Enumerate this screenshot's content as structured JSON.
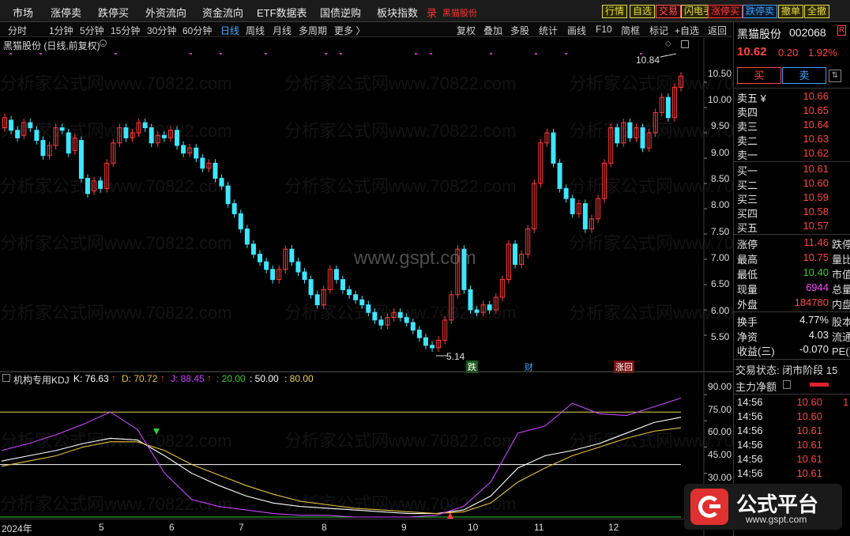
{
  "menu": {
    "items": [
      "市场",
      "涨停卖",
      "跌停买",
      "外资流向",
      "资金流向",
      "ETF数据表",
      "国债逆购",
      "板块指数"
    ],
    "record_label": "录",
    "stock_name_red": "黑猫股份"
  },
  "right_buttons": [
    {
      "label": "行情",
      "color": "#e8d84a",
      "bg": "#2a2a00"
    },
    {
      "label": "自选",
      "color": "#e8d84a",
      "bg": "#2a2a00"
    },
    {
      "label": "交易",
      "color": "#ff5555",
      "bg": "#2a0a0a"
    },
    {
      "label": "闪电手",
      "color": "#e8d84a",
      "bg": "#2a2a00"
    },
    {
      "label": "涨停买",
      "color": "#ff3b3b",
      "bg": "#2a0a0a"
    },
    {
      "label": "跌停卖",
      "color": "#3aa0ff",
      "bg": "#0a1a2a"
    },
    {
      "label": "撤单",
      "color": "#e8d84a",
      "bg": "#2a2a00"
    },
    {
      "label": "全撤",
      "color": "#e8d84a",
      "bg": "#2a2a00"
    }
  ],
  "periods": [
    "分时",
    "1分钟",
    "5分钟",
    "15分钟",
    "30分钟",
    "60分钟",
    "日线",
    "周线",
    "月线",
    "多周期",
    "更多 〉"
  ],
  "active_period": "日线",
  "chart_tools": [
    "复权",
    "叠加",
    "多股",
    "统计",
    "画线",
    "F10",
    "简框",
    "标记",
    "+自选",
    "返回"
  ],
  "chart_title": "黑猫股份 (日线,前复权)",
  "indicator": {
    "name": "机构专用KDJ",
    "k_label": "K: 76.63",
    "d_label": "D: 70.72",
    "j_label": "J: 88.45",
    "l1": ": 20.00",
    "l2": ": 50.00",
    "l3": ": 80.00"
  },
  "price_axis": [
    "10.50",
    "10.00",
    "9.50",
    "9.00",
    "8.50",
    "8.00",
    "7.50",
    "7.00",
    "6.50",
    "6.00",
    "5.50"
  ],
  "kdj_axis": [
    "90.00",
    "75.00",
    "60.00",
    "45.00",
    "30.00"
  ],
  "months": [
    "2024年",
    "5",
    "6",
    "7",
    "8",
    "9",
    "10",
    "11",
    "12"
  ],
  "annotations": {
    "high": "10.84",
    "low": "5.14",
    "m1": "跌",
    "m2": "财",
    "m3": "涨回"
  },
  "watermarks": {
    "w1": "分析家公式网www.70822.com",
    "w2": "www.gspt.com"
  },
  "quote": {
    "name": "黑猫股份",
    "code": "002068",
    "tag": "R",
    "price": "10.62",
    "change": "0.20",
    "pct": "1.92%",
    "buy_button": "买",
    "sell_button": "卖",
    "sells": [
      {
        "label": "卖五 ¥",
        "price": "10.66",
        "vol": ""
      },
      {
        "label": "卖四",
        "price": "10.65",
        "vol": ""
      },
      {
        "label": "卖三",
        "price": "10.64",
        "vol": ""
      },
      {
        "label": "卖二",
        "price": "10.63",
        "vol": ""
      },
      {
        "label": "卖一",
        "price": "10.62",
        "vol": ""
      }
    ],
    "buys": [
      {
        "label": "买一",
        "price": "10.61",
        "vol": ""
      },
      {
        "label": "买二",
        "price": "10.60",
        "vol": ""
      },
      {
        "label": "买三",
        "price": "10.59",
        "vol": ""
      },
      {
        "label": "买四",
        "price": "10.58",
        "vol": ""
      },
      {
        "label": "买五",
        "price": "10.57",
        "vol": ""
      }
    ],
    "stats": [
      {
        "label": "涨停",
        "value": "11.46",
        "color": "#ff4444",
        "extra": "跌停"
      },
      {
        "label": "最高",
        "value": "10.75",
        "color": "#ff4444",
        "extra": "量比"
      },
      {
        "label": "最低",
        "value": "10.40",
        "color": "#33cc33",
        "extra": "市值"
      },
      {
        "label": "现量",
        "value": "6944",
        "color": "#ff44ff",
        "extra": "总量"
      },
      {
        "label": "外盘",
        "value": "184780",
        "color": "#ff4444",
        "extra": "内盘"
      }
    ],
    "stats2": [
      {
        "label": "换手",
        "value": "4.77%",
        "extra": "股本"
      },
      {
        "label": "净资",
        "value": "4.03",
        "extra": "流通"
      },
      {
        "label": "收益(三)",
        "value": "-0.070",
        "extra": "PE(动)"
      }
    ],
    "trade_status": "交易状态: 闭市阶段 15",
    "main_flow": "主力净额",
    "ticks": [
      {
        "time": "14:56",
        "price": "10.60",
        "vol": "1"
      },
      {
        "time": "14:56",
        "price": "10.60",
        "vol": ""
      },
      {
        "time": "14:56",
        "price": "10.61",
        "vol": ""
      },
      {
        "time": "14:56",
        "price": "10.61",
        "vol": ""
      },
      {
        "time": "14:56",
        "price": "10.61",
        "vol": ""
      },
      {
        "time": "14:56",
        "price": "10.61",
        "vol": ""
      },
      {
        "time": "14:56",
        "price": "10.60",
        "vol": ""
      }
    ]
  },
  "logo": {
    "text": "公式平台",
    "url": "www.gspt.com"
  },
  "chart_data": [
    {
      "type": "candlestick",
      "title": "黑猫股份 (日线,前复权)",
      "ylim": [
        5.0,
        10.9
      ],
      "x_months": [
        "2024年",
        "5",
        "6",
        "7",
        "8",
        "9",
        "10",
        "11",
        "12"
      ],
      "annotations": {
        "high": 10.84,
        "low": 5.14
      },
      "candles": [
        {
          "o": 9.6,
          "c": 9.8
        },
        {
          "o": 9.75,
          "c": 9.55
        },
        {
          "o": 9.55,
          "c": 9.4
        },
        {
          "o": 9.45,
          "c": 9.7
        },
        {
          "o": 9.7,
          "c": 9.6
        },
        {
          "o": 9.55,
          "c": 9.35
        },
        {
          "o": 9.35,
          "c": 9.05
        },
        {
          "o": 9.05,
          "c": 9.25
        },
        {
          "o": 9.25,
          "c": 9.6
        },
        {
          "o": 9.6,
          "c": 9.55
        },
        {
          "o": 9.5,
          "c": 9.1
        },
        {
          "o": 9.15,
          "c": 9.4
        },
        {
          "o": 9.35,
          "c": 8.6
        },
        {
          "o": 8.6,
          "c": 8.3
        },
        {
          "o": 8.35,
          "c": 8.55
        },
        {
          "o": 8.55,
          "c": 8.4
        },
        {
          "o": 8.4,
          "c": 8.9
        },
        {
          "o": 8.9,
          "c": 9.3
        },
        {
          "o": 9.3,
          "c": 9.6
        },
        {
          "o": 9.6,
          "c": 9.4
        },
        {
          "o": 9.4,
          "c": 9.5
        },
        {
          "o": 9.5,
          "c": 9.7
        },
        {
          "o": 9.7,
          "c": 9.6
        },
        {
          "o": 9.6,
          "c": 9.3
        },
        {
          "o": 9.3,
          "c": 9.45
        },
        {
          "o": 9.45,
          "c": 9.4
        },
        {
          "o": 9.4,
          "c": 9.55
        },
        {
          "o": 9.55,
          "c": 9.25
        },
        {
          "o": 9.25,
          "c": 9.1
        },
        {
          "o": 9.1,
          "c": 9.2
        },
        {
          "o": 9.2,
          "c": 9.0
        },
        {
          "o": 9.0,
          "c": 8.8
        },
        {
          "o": 8.8,
          "c": 8.9
        },
        {
          "o": 8.9,
          "c": 8.6
        },
        {
          "o": 8.6,
          "c": 8.45
        },
        {
          "o": 8.45,
          "c": 8.1
        },
        {
          "o": 8.1,
          "c": 7.9
        },
        {
          "o": 7.9,
          "c": 7.6
        },
        {
          "o": 7.6,
          "c": 7.3
        },
        {
          "o": 7.3,
          "c": 7.1
        },
        {
          "o": 7.1,
          "c": 6.95
        },
        {
          "o": 6.95,
          "c": 6.8
        },
        {
          "o": 6.8,
          "c": 6.6
        },
        {
          "o": 6.6,
          "c": 6.8
        },
        {
          "o": 6.8,
          "c": 7.2
        },
        {
          "o": 7.2,
          "c": 6.95
        },
        {
          "o": 6.95,
          "c": 6.75
        },
        {
          "o": 6.75,
          "c": 6.6
        },
        {
          "o": 6.6,
          "c": 6.3
        },
        {
          "o": 6.3,
          "c": 6.1
        },
        {
          "o": 6.1,
          "c": 6.4
        },
        {
          "o": 6.4,
          "c": 6.8
        },
        {
          "o": 6.8,
          "c": 6.6
        },
        {
          "o": 6.6,
          "c": 6.4
        },
        {
          "o": 6.4,
          "c": 6.3
        },
        {
          "o": 6.3,
          "c": 6.2
        },
        {
          "o": 6.2,
          "c": 6.1
        },
        {
          "o": 6.1,
          "c": 5.95
        },
        {
          "o": 5.95,
          "c": 5.8
        },
        {
          "o": 5.8,
          "c": 5.7
        },
        {
          "o": 5.7,
          "c": 5.85
        },
        {
          "o": 5.85,
          "c": 5.95
        },
        {
          "o": 5.95,
          "c": 5.85
        },
        {
          "o": 5.85,
          "c": 5.75
        },
        {
          "o": 5.75,
          "c": 5.6
        },
        {
          "o": 5.6,
          "c": 5.45
        },
        {
          "o": 5.45,
          "c": 5.3
        },
        {
          "o": 5.3,
          "c": 5.25
        },
        {
          "o": 5.25,
          "c": 5.4
        },
        {
          "o": 5.4,
          "c": 5.8
        },
        {
          "o": 5.8,
          "c": 6.3
        },
        {
          "o": 6.3,
          "c": 7.2
        },
        {
          "o": 7.2,
          "c": 6.4
        },
        {
          "o": 6.4,
          "c": 6.0
        },
        {
          "o": 6.0,
          "c": 5.95
        },
        {
          "o": 5.95,
          "c": 6.1
        },
        {
          "o": 6.1,
          "c": 6.0
        },
        {
          "o": 6.0,
          "c": 6.25
        },
        {
          "o": 6.25,
          "c": 6.6
        },
        {
          "o": 6.6,
          "c": 7.3
        },
        {
          "o": 7.3,
          "c": 6.9
        },
        {
          "o": 6.9,
          "c": 7.1
        },
        {
          "o": 7.1,
          "c": 7.6
        },
        {
          "o": 7.6,
          "c": 8.5
        },
        {
          "o": 8.5,
          "c": 9.3
        },
        {
          "o": 9.3,
          "c": 9.5
        },
        {
          "o": 9.5,
          "c": 8.9
        },
        {
          "o": 8.9,
          "c": 8.4
        },
        {
          "o": 8.4,
          "c": 8.2
        },
        {
          "o": 8.2,
          "c": 7.9
        },
        {
          "o": 7.9,
          "c": 8.1
        },
        {
          "o": 8.1,
          "c": 7.6
        },
        {
          "o": 7.6,
          "c": 7.8
        },
        {
          "o": 7.8,
          "c": 8.2
        },
        {
          "o": 8.2,
          "c": 8.9
        },
        {
          "o": 8.9,
          "c": 9.6
        },
        {
          "o": 9.6,
          "c": 9.3
        },
        {
          "o": 9.3,
          "c": 9.7
        },
        {
          "o": 9.7,
          "c": 9.4
        },
        {
          "o": 9.4,
          "c": 9.6
        },
        {
          "o": 9.6,
          "c": 9.2
        },
        {
          "o": 9.2,
          "c": 9.5
        },
        {
          "o": 9.5,
          "c": 9.9
        },
        {
          "o": 9.9,
          "c": 10.2
        },
        {
          "o": 10.2,
          "c": 9.8
        },
        {
          "o": 9.8,
          "c": 10.4
        },
        {
          "o": 10.4,
          "c": 10.62
        }
      ]
    },
    {
      "type": "line",
      "title": "机构专用KDJ",
      "ylim": [
        20,
        95
      ],
      "reference_lines": [
        20,
        50,
        80
      ],
      "series": [
        {
          "name": "K",
          "color": "#ffffff",
          "values": [
            52,
            55,
            58,
            62,
            65,
            64,
            55,
            45,
            38,
            32,
            28,
            26,
            25,
            24,
            23,
            22,
            22,
            24,
            32,
            48,
            55,
            58,
            62,
            68,
            74,
            77
          ]
        },
        {
          "name": "D",
          "color": "#e8c040",
          "values": [
            49,
            52,
            55,
            60,
            63,
            63,
            58,
            50,
            44,
            38,
            33,
            29,
            27,
            25,
            24,
            23,
            22,
            23,
            28,
            40,
            48,
            55,
            60,
            65,
            69,
            71
          ]
        },
        {
          "name": "J",
          "color": "#cc44ff",
          "values": [
            58,
            62,
            67,
            73,
            80,
            70,
            45,
            30,
            26,
            24,
            22,
            21,
            21,
            20,
            20,
            20,
            21,
            26,
            40,
            68,
            72,
            85,
            79,
            78,
            83,
            88
          ]
        }
      ]
    }
  ]
}
